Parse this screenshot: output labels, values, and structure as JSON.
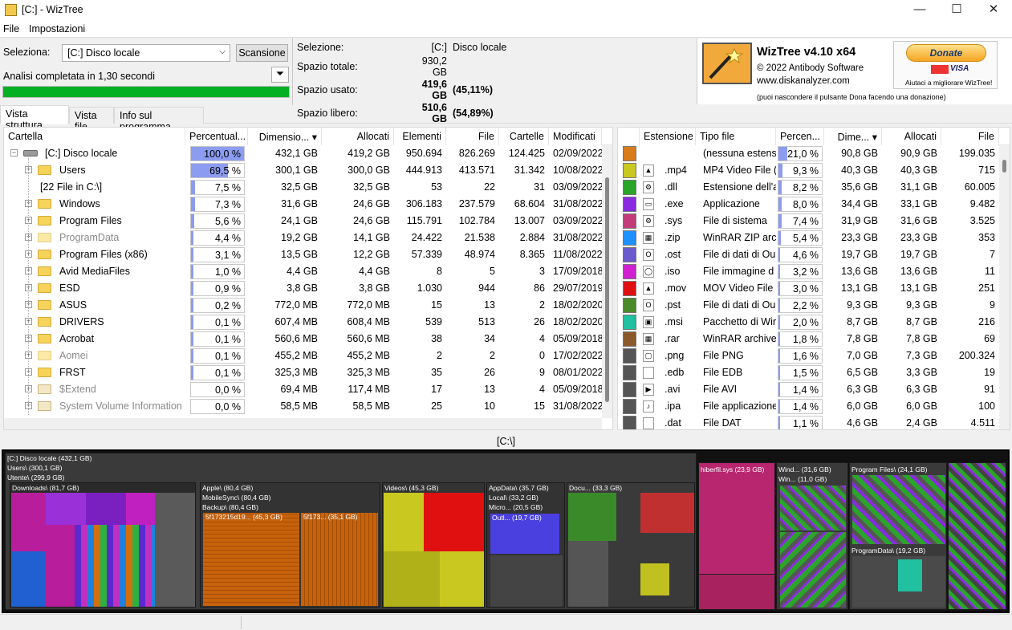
{
  "window": {
    "title": "[C:]  - WizTree",
    "minimize": "—",
    "maximize": "☐",
    "close": "✕"
  },
  "menu": {
    "file": "File",
    "settings": "Impostazioni"
  },
  "top": {
    "select_label": "Seleziona:",
    "drive_value": "[C:] Disco locale",
    "scan_button": "Scansione",
    "status": "Analisi completata in 1,30 secondi",
    "progress": 1.0
  },
  "info": {
    "selection_label": "Selezione:",
    "selection_drive": "[C:]",
    "selection_name": "Disco locale",
    "total_label": "Spazio totale:",
    "total_value": "930,2 GB",
    "used_label": "Spazio usato:",
    "used_value": "419,6 GB",
    "used_pct": "(45,11%)",
    "free_label": "Spazio libero:",
    "free_value": "510,6 GB",
    "free_pct": "(54,89%)"
  },
  "logo": {
    "app_name": "WizTree v4.10 x64",
    "copyright": "© 2022 Antibody Software",
    "website": "www.diskanalyzer.com",
    "donate": "Donate",
    "donate_help": "Aiutaci a migliorare WizTree!",
    "hide_note": "(puoi nascondere il pulsante Dona facendo una donazione)"
  },
  "tabs": [
    "Vista struttura",
    "Vista file",
    "Info sul programma"
  ],
  "tree": {
    "headers": [
      "Cartella",
      "Percentual...",
      "Dimensio... ▾",
      "Allocati",
      "Elementi",
      "File",
      "Cartelle",
      "Modificati"
    ],
    "rows": [
      {
        "name": "[C:] Disco locale",
        "pct": "100,0 %",
        "fill": 1.0,
        "size": "432,1 GB",
        "alloc": "419,2 GB",
        "items": "950.694",
        "files": "826.269",
        "folders": "124.425",
        "mod": "02/09/2022",
        "kind": "drive"
      },
      {
        "name": "Users",
        "pct": "69,5 %",
        "fill": 0.695,
        "size": "300,1 GB",
        "alloc": "300,0 GB",
        "items": "444.913",
        "files": "413.571",
        "folders": "31.342",
        "mod": "10/08/2022",
        "kind": "folder"
      },
      {
        "name": "[22 File in C:\\]",
        "pct": "7,5 %",
        "fill": 0.075,
        "size": "32,5 GB",
        "alloc": "32,5 GB",
        "items": "53",
        "files": "22",
        "folders": "31",
        "mod": "03/09/2022",
        "kind": "none"
      },
      {
        "name": "Windows",
        "pct": "7,3 %",
        "fill": 0.073,
        "size": "31,6 GB",
        "alloc": "24,6 GB",
        "items": "306.183",
        "files": "237.579",
        "folders": "68.604",
        "mod": "31/08/2022",
        "kind": "folder"
      },
      {
        "name": "Program Files",
        "pct": "5,6 %",
        "fill": 0.056,
        "size": "24,1 GB",
        "alloc": "24,6 GB",
        "items": "115.791",
        "files": "102.784",
        "folders": "13.007",
        "mod": "03/09/2022",
        "kind": "folder"
      },
      {
        "name": "ProgramData",
        "pct": "4,4 %",
        "fill": 0.044,
        "size": "19,2 GB",
        "alloc": "14,1 GB",
        "items": "24.422",
        "files": "21.538",
        "folders": "2.884",
        "mod": "31/08/2022",
        "kind": "dim"
      },
      {
        "name": "Program Files (x86)",
        "pct": "3,1 %",
        "fill": 0.031,
        "size": "13,5 GB",
        "alloc": "12,2 GB",
        "items": "57.339",
        "files": "48.974",
        "folders": "8.365",
        "mod": "11/08/2022",
        "kind": "folder"
      },
      {
        "name": "Avid MediaFiles",
        "pct": "1,0 %",
        "fill": 0.01,
        "size": "4,4 GB",
        "alloc": "4,4 GB",
        "items": "8",
        "files": "5",
        "folders": "3",
        "mod": "17/09/2018",
        "kind": "folder"
      },
      {
        "name": "ESD",
        "pct": "0,9 %",
        "fill": 0.009,
        "size": "3,8 GB",
        "alloc": "3,8 GB",
        "items": "1.030",
        "files": "944",
        "folders": "86",
        "mod": "29/07/2019",
        "kind": "folder"
      },
      {
        "name": "ASUS",
        "pct": "0,2 %",
        "fill": 0.002,
        "size": "772,0 MB",
        "alloc": "772,0 MB",
        "items": "15",
        "files": "13",
        "folders": "2",
        "mod": "18/02/2020",
        "kind": "folder"
      },
      {
        "name": "DRIVERS",
        "pct": "0,1 %",
        "fill": 0.001,
        "size": "607,4 MB",
        "alloc": "608,4 MB",
        "items": "539",
        "files": "513",
        "folders": "26",
        "mod": "18/02/2020",
        "kind": "folder"
      },
      {
        "name": "Acrobat",
        "pct": "0,1 %",
        "fill": 0.001,
        "size": "560,6 MB",
        "alloc": "560,6 MB",
        "items": "38",
        "files": "34",
        "folders": "4",
        "mod": "05/09/2018",
        "kind": "folder"
      },
      {
        "name": "Aomei",
        "pct": "0,1 %",
        "fill": 0.001,
        "size": "455,2 MB",
        "alloc": "455,2 MB",
        "items": "2",
        "files": "2",
        "folders": "0",
        "mod": "17/02/2022",
        "kind": "dim"
      },
      {
        "name": "FRST",
        "pct": "0,1 %",
        "fill": 0.001,
        "size": "325,3 MB",
        "alloc": "325,3 MB",
        "items": "35",
        "files": "26",
        "folders": "9",
        "mod": "08/01/2022",
        "kind": "folder"
      },
      {
        "name": "$Extend",
        "pct": "0,0 %",
        "fill": 0.0,
        "size": "69,4 MB",
        "alloc": "117,4 MB",
        "items": "17",
        "files": "13",
        "folders": "4",
        "mod": "05/09/2018",
        "kind": "sys"
      },
      {
        "name": "System Volume Information",
        "pct": "0,0 %",
        "fill": 0.0,
        "size": "58,5 MB",
        "alloc": "58,5 MB",
        "items": "25",
        "files": "10",
        "folders": "15",
        "mod": "31/08/2022",
        "kind": "sys"
      }
    ]
  },
  "ext": {
    "headers": [
      "",
      "Estensione",
      "Tipo file",
      "Percen...",
      "Dime... ▾",
      "Allocati",
      "File"
    ],
    "rows": [
      {
        "color": "#d97b1a",
        "ext": "",
        "type": "(nessuna estensi",
        "pct": "21,0 %",
        "fill": 0.21,
        "size": "90,8 GB",
        "alloc": "90,9 GB",
        "files": "199.035",
        "icon": ""
      },
      {
        "color": "#c8c820",
        "ext": ".mp4",
        "type": "MP4 Video File (",
        "pct": "9,3 %",
        "fill": 0.093,
        "size": "40,3 GB",
        "alloc": "40,3 GB",
        "files": "715",
        "icon": "▲"
      },
      {
        "color": "#2aa52a",
        "ext": ".dll",
        "type": "Estensione dell'a",
        "pct": "8,2 %",
        "fill": 0.082,
        "size": "35,6 GB",
        "alloc": "31,1 GB",
        "files": "60.005",
        "icon": "⚙"
      },
      {
        "color": "#8a2be2",
        "ext": ".exe",
        "type": "Applicazione",
        "pct": "8,0 %",
        "fill": 0.08,
        "size": "34,4 GB",
        "alloc": "33,1 GB",
        "files": "9.482",
        "icon": "▭"
      },
      {
        "color": "#c23c7a",
        "ext": ".sys",
        "type": "File di sistema",
        "pct": "7,4 %",
        "fill": 0.074,
        "size": "31,9 GB",
        "alloc": "31,6 GB",
        "files": "3.525",
        "icon": "⚙"
      },
      {
        "color": "#1e90ff",
        "ext": ".zip",
        "type": "WinRAR ZIP arch",
        "pct": "5,4 %",
        "fill": 0.054,
        "size": "23,3 GB",
        "alloc": "23,3 GB",
        "files": "353",
        "icon": "▦"
      },
      {
        "color": "#6a5acd",
        "ext": ".ost",
        "type": "File di dati di Ou",
        "pct": "4,6 %",
        "fill": 0.046,
        "size": "19,7 GB",
        "alloc": "19,7 GB",
        "files": "7",
        "icon": "O"
      },
      {
        "color": "#d020d0",
        "ext": ".iso",
        "type": "File immagine d",
        "pct": "3,2 %",
        "fill": 0.032,
        "size": "13,6 GB",
        "alloc": "13,6 GB",
        "files": "11",
        "icon": "◯"
      },
      {
        "color": "#e01010",
        "ext": ".mov",
        "type": "MOV Video File (",
        "pct": "3,0 %",
        "fill": 0.03,
        "size": "13,1 GB",
        "alloc": "13,1 GB",
        "files": "251",
        "icon": "▲"
      },
      {
        "color": "#4a8a2a",
        "ext": ".pst",
        "type": "File di dati di Ou",
        "pct": "2,2 %",
        "fill": 0.022,
        "size": "9,3 GB",
        "alloc": "9,3 GB",
        "files": "9",
        "icon": "O"
      },
      {
        "color": "#20c0a0",
        "ext": ".msi",
        "type": "Pacchetto di Wir",
        "pct": "2,0 %",
        "fill": 0.02,
        "size": "8,7 GB",
        "alloc": "8,7 GB",
        "files": "216",
        "icon": "▣"
      },
      {
        "color": "#8b5a2b",
        "ext": ".rar",
        "type": "WinRAR archive",
        "pct": "1,8 %",
        "fill": 0.018,
        "size": "7,8 GB",
        "alloc": "7,8 GB",
        "files": "69",
        "icon": "▦"
      },
      {
        "color": "#555555",
        "ext": ".png",
        "type": "File PNG",
        "pct": "1,6 %",
        "fill": 0.016,
        "size": "7,0 GB",
        "alloc": "7,3 GB",
        "files": "200.324",
        "icon": "▢"
      },
      {
        "color": "#555555",
        "ext": ".edb",
        "type": "File EDB",
        "pct": "1,5 %",
        "fill": 0.015,
        "size": "6,5 GB",
        "alloc": "3,3 GB",
        "files": "19",
        "icon": ""
      },
      {
        "color": "#555555",
        "ext": ".avi",
        "type": "File AVI",
        "pct": "1,4 %",
        "fill": 0.014,
        "size": "6,3 GB",
        "alloc": "6,3 GB",
        "files": "91",
        "icon": "▶"
      },
      {
        "color": "#555555",
        "ext": ".ipa",
        "type": "File applicazione",
        "pct": "1,4 %",
        "fill": 0.014,
        "size": "6,0 GB",
        "alloc": "6,0 GB",
        "files": "100",
        "icon": "♪"
      },
      {
        "color": "#555555",
        "ext": ".dat",
        "type": "File DAT",
        "pct": "1,1 %",
        "fill": 0.011,
        "size": "4,6 GB",
        "alloc": "2,4 GB",
        "files": "4.511",
        "icon": ""
      }
    ]
  },
  "treemap_path": "[C:\\]",
  "treemap": {
    "root": "[C:] Disco locale  (432,1 GB)",
    "users": "Users\\ (300,1 GB)",
    "utente": "Utente\\ (299,9 GB)",
    "downloads": "Downloads\\ (81,7 GB)",
    "apple": "Apple\\ (80,4 GB)",
    "mobilesync": "MobileSync\\ (80,4 GB)",
    "backup": "Backup\\ (80,4 GB)",
    "b1": "5f173215d19... (45,3 GB)",
    "b2": "5f173... (35,1 GB)",
    "videos": "Videos\\ (45,3 GB)",
    "appdata": "AppData\\ (35,7 GB)",
    "local": "Local\\ (33,2 GB)",
    "micro": "Micro... (20,5 GB)",
    "outl": "Outl... (19,7 GB)",
    "docu": "Docu... (33,3 GB)",
    "hiberfil": "hiberfil.sys (23,9 GB)",
    "windows": "Wind... (31,6 GB)",
    "win2": "Win... (11,0 GB)",
    "programfiles": "Program Files\\ (24,1 GB)",
    "programdata": "ProgramData\\ (19,2 GB)"
  }
}
